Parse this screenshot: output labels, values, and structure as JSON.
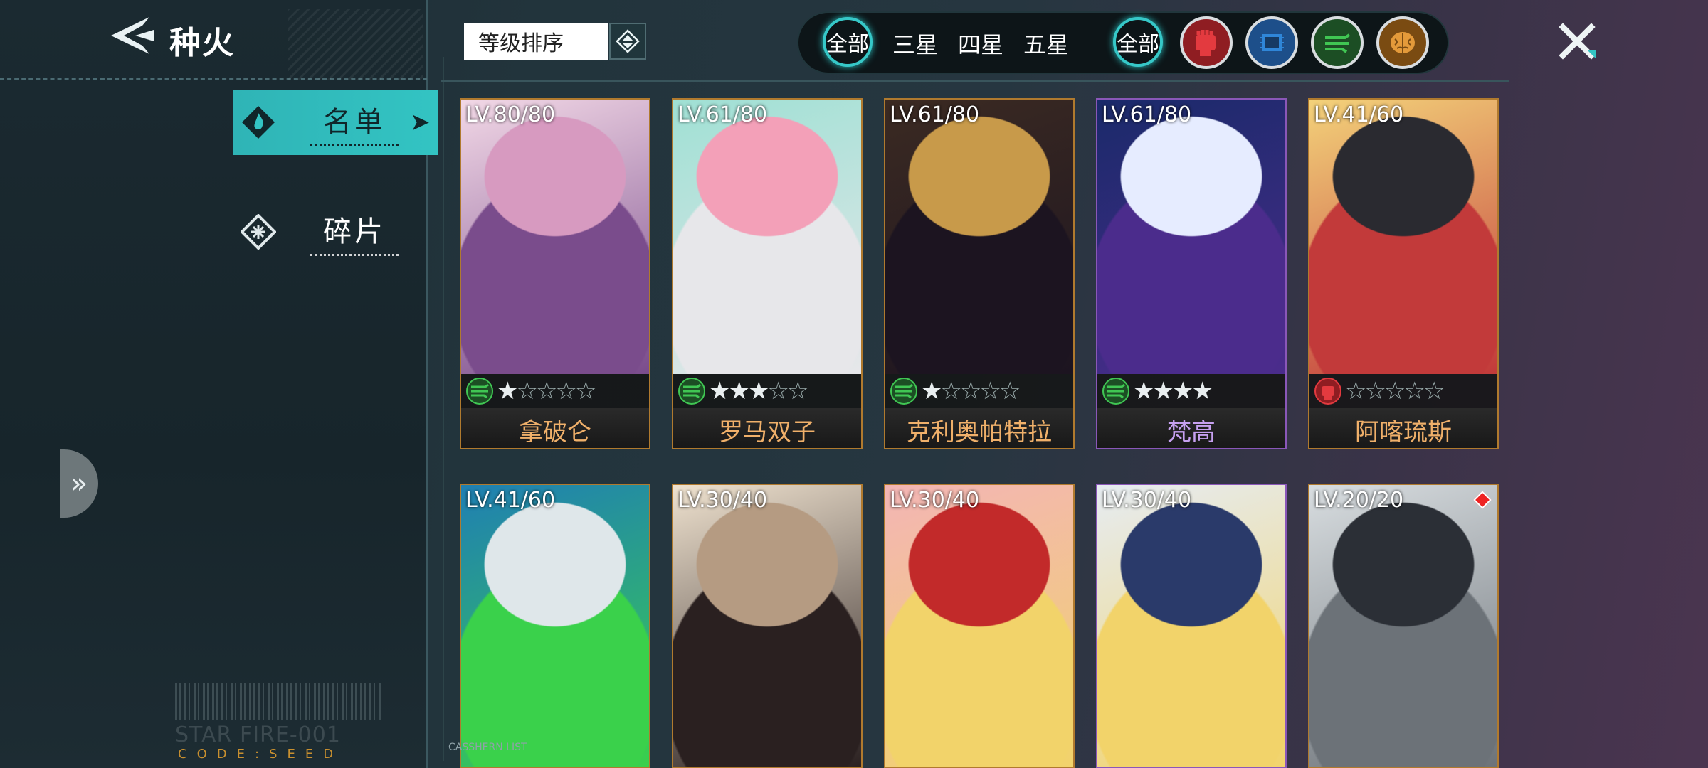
{
  "header": {
    "title": "种火"
  },
  "sidebar": {
    "items": [
      {
        "label": "名单",
        "active": true
      },
      {
        "label": "碎片",
        "active": false
      }
    ]
  },
  "decor": {
    "starfire": "STAR FIRE-001",
    "code": "CODE:SEED",
    "list_label": "CASSHERN LIST"
  },
  "sort": {
    "selected": "等级排序"
  },
  "filters": {
    "stars": [
      "全部",
      "三星",
      "四星",
      "五星"
    ],
    "types_all": "全部",
    "type_icons": [
      "fist-type-icon",
      "chip-type-icon",
      "speed-type-icon",
      "brain-type-icon"
    ]
  },
  "colors": {
    "accent": "#33c4c3",
    "card_gold": "#b07a2e",
    "card_purple": "#8a57b8",
    "name_gold": "#f0b06a",
    "name_purple": "#c6a0f0"
  },
  "cards": [
    {
      "level": "LV.80/80",
      "name": "拿破仑",
      "element": "speed",
      "stars": 5,
      "filled": 1
    },
    {
      "level": "LV.61/80",
      "name": "罗马双子",
      "element": "speed",
      "stars": 5,
      "filled": 3
    },
    {
      "level": "LV.61/80",
      "name": "克利奥帕特拉",
      "element": "speed",
      "stars": 5,
      "filled": 1
    },
    {
      "level": "LV.61/80",
      "name": "梵高",
      "element": "speed",
      "stars": 4,
      "filled": 4
    },
    {
      "level": "LV.41/60",
      "name": "阿喀琉斯",
      "element": "fist",
      "stars": 5,
      "filled": 0
    },
    {
      "level": "LV.41/60",
      "name": "",
      "element": "",
      "stars": 0,
      "filled": 0
    },
    {
      "level": "LV.30/40",
      "name": "",
      "element": "",
      "stars": 0,
      "filled": 0
    },
    {
      "level": "LV.30/40",
      "name": "",
      "element": "",
      "stars": 0,
      "filled": 0
    },
    {
      "level": "LV.30/40",
      "name": "",
      "element": "",
      "stars": 0,
      "filled": 0
    },
    {
      "level": "LV.20/20",
      "name": "",
      "element": "",
      "stars": 0,
      "filled": 0
    }
  ]
}
